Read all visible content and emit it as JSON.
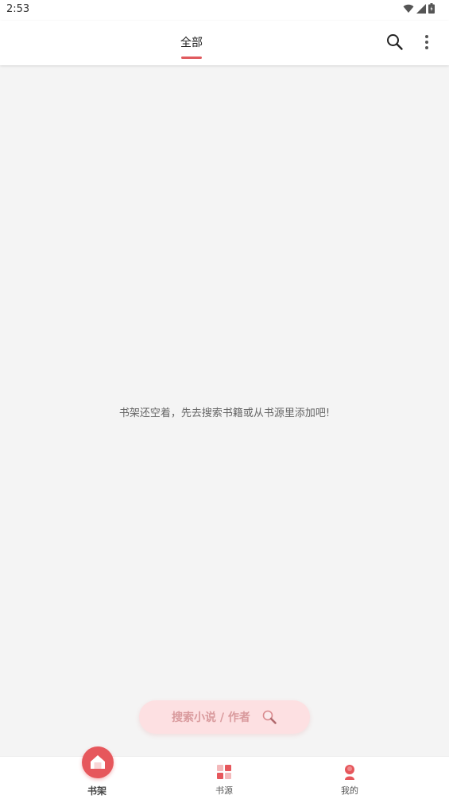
{
  "status_bar": {
    "time": "2:53",
    "icons": [
      "wifi-icon",
      "signal-icon",
      "battery-icon"
    ]
  },
  "app_bar": {
    "tabs": [
      {
        "label": "全部",
        "active": true
      }
    ],
    "actions": [
      "search-icon",
      "more-vert-icon"
    ]
  },
  "content": {
    "empty_message": "书架还空着，先去搜索书籍或从书源里添加吧!"
  },
  "fab": {
    "label": "搜索小说 / 作者",
    "icon": "magnifier-icon"
  },
  "bottom_nav": {
    "items": [
      {
        "label": "书架",
        "icon": "bookshelf-icon",
        "active": true
      },
      {
        "label": "书源",
        "icon": "book-source-icon",
        "active": false
      },
      {
        "label": "我的",
        "icon": "profile-icon",
        "active": false
      }
    ]
  },
  "colors": {
    "accent": "#e05a5e",
    "fab_bg": "#fde0e2",
    "fab_text": "#d99a9d",
    "background": "#f4f4f4"
  }
}
